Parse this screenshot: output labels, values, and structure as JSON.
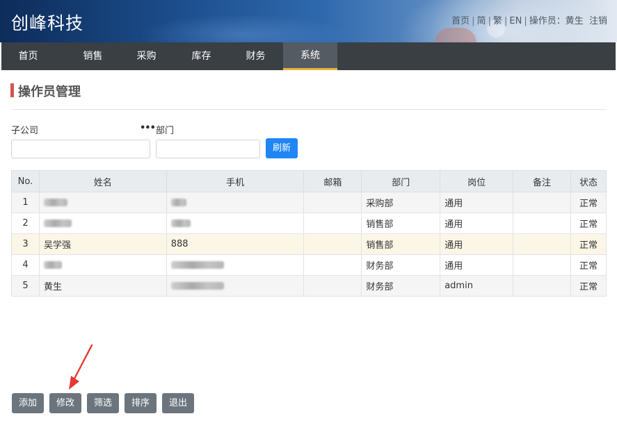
{
  "header": {
    "brand": "创峰科技",
    "links": {
      "home": "首页",
      "simplified": "简",
      "traditional": "繁",
      "english": "EN",
      "operator_label": "操作员：黄生",
      "logout": "注销"
    }
  },
  "nav": {
    "items": [
      {
        "label": "首页"
      },
      {
        "label": "销售"
      },
      {
        "label": "采购"
      },
      {
        "label": "库存"
      },
      {
        "label": "财务"
      },
      {
        "label": "系统"
      }
    ],
    "active": "系统"
  },
  "page": {
    "title": "操作员管理"
  },
  "filter": {
    "company_label": "子公司",
    "company_value": "",
    "dept_label": "部门",
    "dept_value": "",
    "refresh_label": "刷新"
  },
  "table": {
    "columns": [
      "No.",
      "姓名",
      "手机",
      "邮箱",
      "部门",
      "岗位",
      "备注",
      "状态"
    ],
    "rows": [
      {
        "no": "1",
        "name": "",
        "phone": "",
        "email": "",
        "dept": "采购部",
        "post": "通用",
        "note": "",
        "status": "正常"
      },
      {
        "no": "2",
        "name": "",
        "phone": "",
        "email": "",
        "dept": "销售部",
        "post": "通用",
        "note": "",
        "status": "正常"
      },
      {
        "no": "3",
        "name": "吴学强",
        "phone": "888",
        "email": "",
        "dept": "销售部",
        "post": "通用",
        "note": "",
        "status": "正常"
      },
      {
        "no": "4",
        "name": "",
        "phone": "",
        "email": "",
        "dept": "财务部",
        "post": "通用",
        "note": "",
        "status": "正常"
      },
      {
        "no": "5",
        "name": "黄生",
        "phone": "",
        "email": "",
        "dept": "财务部",
        "post": "admin",
        "note": "",
        "status": "正常"
      }
    ]
  },
  "actions": {
    "add": "添加",
    "edit": "修改",
    "filter": "筛选",
    "sort": "排序",
    "exit": "退出"
  },
  "colors": {
    "accent": "#1f86f5",
    "nav_bg": "#3a3f44",
    "nav_active_underline": "#e9b43a",
    "title_marker": "#d9534f",
    "selected_row": "#fcf6e6",
    "annotation_arrow": "#e53935"
  }
}
